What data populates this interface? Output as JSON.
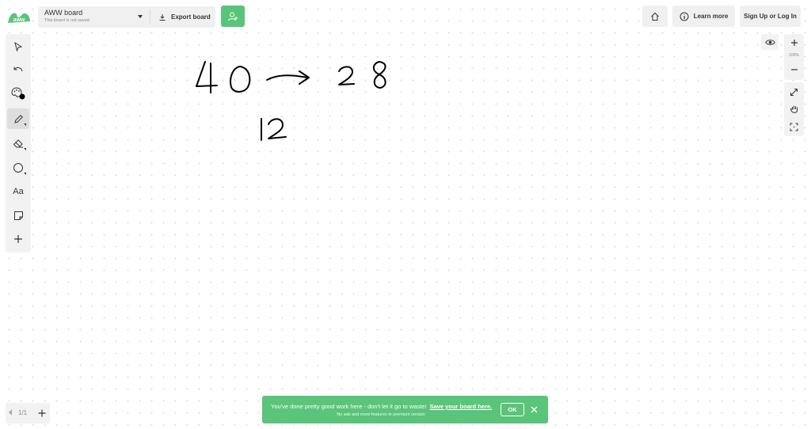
{
  "header": {
    "board_name": "AWW board",
    "board_status": "This board is not saved",
    "export_label": "Export board",
    "learn_more_label": "Learn more",
    "signup_label": "Sign Up or Log In"
  },
  "toolbar": {
    "tools": [
      "select",
      "undo",
      "color",
      "pen",
      "eraser",
      "shape",
      "text",
      "sticky-note",
      "add"
    ],
    "active_tool": "pen",
    "text_tool_label": "Aa",
    "current_color": "#000000"
  },
  "zoom": {
    "level": "100%"
  },
  "pages": {
    "indicator": "1/1"
  },
  "banner": {
    "message": "You've done pretty good work here - don't let it go to waste!",
    "link": "Save your board here.",
    "subtext": "No ads and more features in premium version",
    "ok_label": "OK"
  },
  "colors": {
    "brand_green": "#5ac47a",
    "panel_bg": "#f2f2f2",
    "ink": "#000000"
  }
}
